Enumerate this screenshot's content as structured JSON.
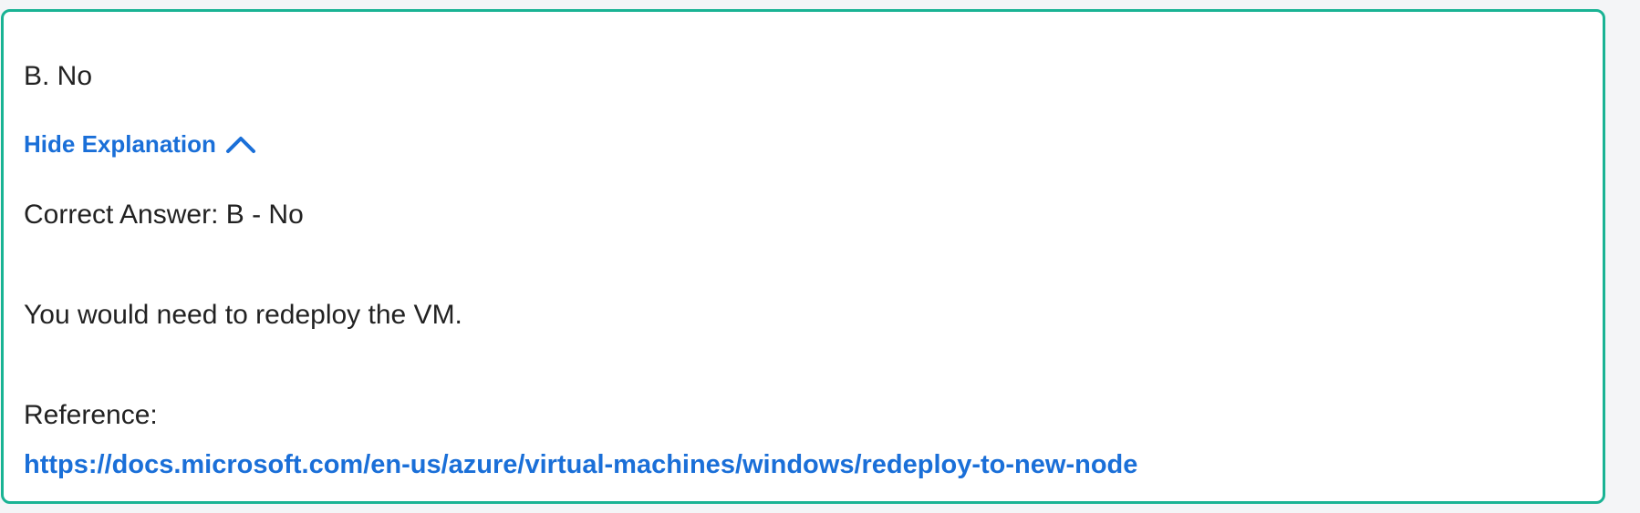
{
  "option": {
    "label": "B. No"
  },
  "explanation_toggle": {
    "label": "Hide Explanation",
    "icon": "chevron-up-icon"
  },
  "explanation": {
    "correct_answer": "Correct Answer: B - No",
    "body": "You would need to redeploy the VM.",
    "reference_label": "Reference:",
    "reference_url": "https://docs.microsoft.com/en-us/azure/virtual-machines/windows/redeploy-to-new-node"
  },
  "colors": {
    "border_accent": "#1ab394",
    "link": "#1a6fd8",
    "text": "#222222"
  }
}
